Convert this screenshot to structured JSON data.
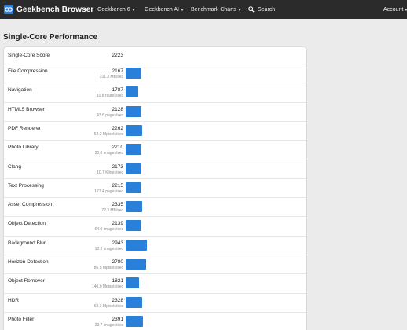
{
  "navbar": {
    "brand": "Geekbench Browser",
    "items": [
      "Geekbench 6",
      "Geekbench AI",
      "Benchmark Charts"
    ],
    "search": "Search",
    "account": "Account"
  },
  "page": {
    "title": "Single-Core Performance"
  },
  "summary": {
    "label": "Single-Core Score",
    "score": "2223"
  },
  "max_score": 2943,
  "benchmarks": [
    {
      "name": "File Compression",
      "score": "2167",
      "rate": "311.3 MB/sec"
    },
    {
      "name": "Navigation",
      "score": "1787",
      "rate": "10.8 routes/sec"
    },
    {
      "name": "HTML5 Browser",
      "score": "2128",
      "rate": "43.6 pages/sec"
    },
    {
      "name": "PDF Renderer",
      "score": "2262",
      "rate": "52.2 Mpixels/sec"
    },
    {
      "name": "Photo Library",
      "score": "2210",
      "rate": "30.0 images/sec"
    },
    {
      "name": "Clang",
      "score": "2173",
      "rate": "10.7 Klines/sec"
    },
    {
      "name": "Text Processing",
      "score": "2215",
      "rate": "177.4 pages/sec"
    },
    {
      "name": "Asset Compression",
      "score": "2335",
      "rate": "72.3 MB/sec"
    },
    {
      "name": "Object Detection",
      "score": "2139",
      "rate": "64.0 images/sec"
    },
    {
      "name": "Background Blur",
      "score": "2943",
      "rate": "12.2 images/sec"
    },
    {
      "name": "Horizon Detection",
      "score": "2780",
      "rate": "86.5 Mpixels/sec"
    },
    {
      "name": "Object Remover",
      "score": "1821",
      "rate": "140.0 Mpixels/sec"
    },
    {
      "name": "HDR",
      "score": "2328",
      "rate": "68.3 Mpixels/sec"
    },
    {
      "name": "Photo Filter",
      "score": "2391",
      "rate": "23.7 images/sec"
    }
  ],
  "colors": {
    "bar": "#2a7fd8",
    "navbar": "#2b2b2b"
  }
}
